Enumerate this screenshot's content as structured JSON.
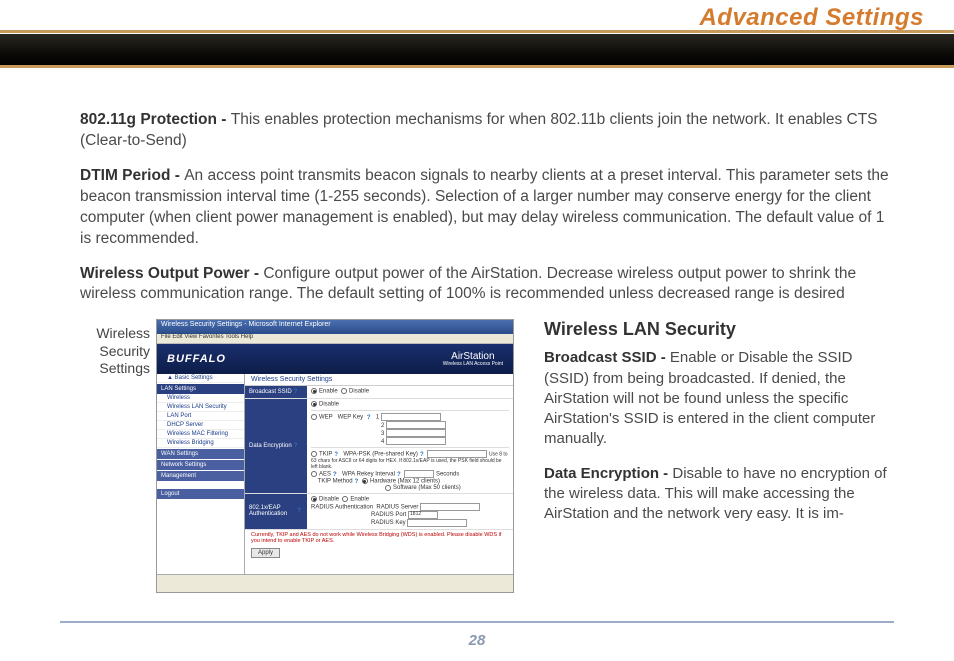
{
  "header": {
    "title": "Advanced Settings"
  },
  "paragraphs": {
    "p1_label": "802.11g Protection - ",
    "p1_text": "This enables protection mechanisms for when 802.11b clients join the network.  It enables CTS (Clear-to-Send)",
    "p2_label": "DTIM Period - ",
    "p2_text": "An access point transmits beacon signals to nearby clients at a preset interval.  This parameter sets the beacon transmission interval time (1-255 seconds). Selection of a larger number may conserve energy for the client computer (when client power management is enabled), but may delay wireless communication.  The default value of 1 is recommended.",
    "p3_label": "Wireless Output Power - ",
    "p3_text": "Configure output power of the AirStation. Decrease wireless output power to shrink the wireless communication range.  The default setting of 100% is recommended unless decreased range is desired"
  },
  "screenshot_caption": "Wireless Security Settings",
  "screenshot": {
    "window_title": "Wireless Security Settings - Microsoft Internet Explorer",
    "menubar": "File   Edit   View   Favorites   Tools   Help",
    "brand_left": "BUFFALO",
    "brand_right_top": "AirStation",
    "brand_right_sub": "Wireless LAN Access Point",
    "sidebar": {
      "basic": "▲ Basic Settings",
      "lan_head": "LAN Settings",
      "items": [
        "Wireless",
        "Wireless LAN Security",
        "LAN Port",
        "DHCP Server",
        "Wireless MAC Filtering",
        "Wireless Bridging"
      ],
      "wan_head": "WAN Settings",
      "net_head": "Network Settings",
      "mgmt_head": "Management",
      "logout": "Logout"
    },
    "main": {
      "title": "Wireless Security Settings",
      "broadcast_label": "Broadcast SSID",
      "enable": "Enable",
      "disable": "Disable",
      "data_enc_label": "Data Encryption",
      "wep": "WEP",
      "wep_key": "WEP Key",
      "tkip": "TKIP",
      "aes": "AES",
      "psk": "WPA-PSK (Pre-shared Key)",
      "psk_hint": "Use 8 to 63 chars for ASCII or 64 digits for HEX. If 802.1x/EAP is used, the PSK field should be left blank.",
      "rekey": "WPA Rekey Interval",
      "seconds": "Seconds",
      "tkip_method": "TKIP Method",
      "hw": "Hardware (Max 12 clients)",
      "sw": "Software (Max 50 clients)",
      "eap_label": "802.1x/EAP Authentication",
      "radius_auth": "RADIUS Authentication",
      "radius_server": "RADIUS Server",
      "radius_port": "RADIUS Port",
      "radius_port_val": "1812",
      "radius_key": "RADIUS Key",
      "warn": "Currently, TKIP and AES do not work while Wireless Bridging (WDS) is enabled. Please disable WDS if you intend to enable TKIP or AES.",
      "apply": "Apply"
    }
  },
  "right": {
    "heading": "Wireless LAN Security",
    "r1_label": "Broadcast SSID - ",
    "r1_text": "Enable or Disable the SSID (SSID) from being broadcasted. If denied,  the AirStation will not be found unless the specific AirStation's SSID is entered in the client computer manually.",
    "r2_label": "Data Encryption - ",
    "r2_text": "Disable to have no encryption of the wireless data.  This will make accessing the AirStation and the network very easy.  It is im-"
  },
  "page_number": "28"
}
